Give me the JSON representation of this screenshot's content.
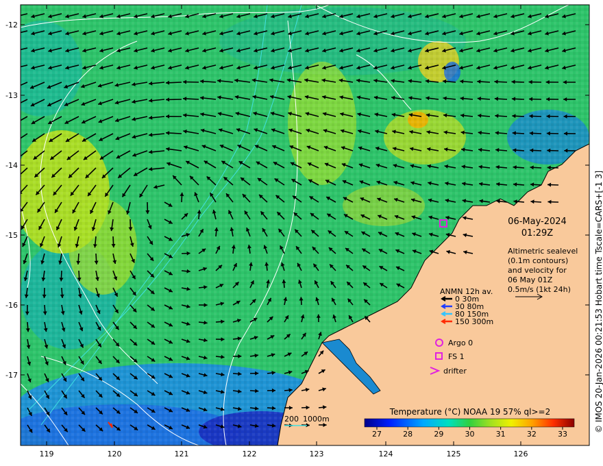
{
  "date_label": "06-May-2024",
  "time_label": "01:29Z",
  "altimetry": {
    "line1": "Altimetric sealevel",
    "line2": "(0.1m contours)",
    "line3": "and velocity for",
    "line4": "06 May 01Z",
    "scale_label": "0.5m/s (1kt 24h)"
  },
  "anmn": {
    "title": "ANMN 12h av.",
    "items": [
      {
        "label": "0 30m",
        "color": "#000000"
      },
      {
        "label": "30 80m",
        "color": "#1f3cff"
      },
      {
        "label": "80 150m",
        "color": "#33c4ff"
      },
      {
        "label": "150 300m",
        "color": "#ff2a00"
      }
    ]
  },
  "markers": {
    "argo": "Argo 0",
    "fs": "FS 1",
    "drifter": "drifter",
    "marker_color": "#e020e0"
  },
  "bathy_label_1": "200",
  "bathy_label_2": "1000m",
  "colorbar": {
    "title": "Temperature (°C) NOAA 19 57% ql>=2",
    "ticks": [
      "27",
      "28",
      "29",
      "30",
      "31",
      "32",
      "33"
    ]
  },
  "side_text": "© IMOS 20-Jan-2026 00:21:53 Hobart time Tscale=CARS+[-1 3]",
  "axes": {
    "x_ticks": [
      "119",
      "120",
      "121",
      "122",
      "123",
      "124",
      "125",
      "126"
    ],
    "y_ticks": [
      "-12",
      "-13",
      "-14",
      "-15",
      "-16",
      "-17"
    ]
  },
  "colors": {
    "land": "#f9c99b",
    "contour": "#ffffff",
    "bathy": "#40e0e0"
  }
}
